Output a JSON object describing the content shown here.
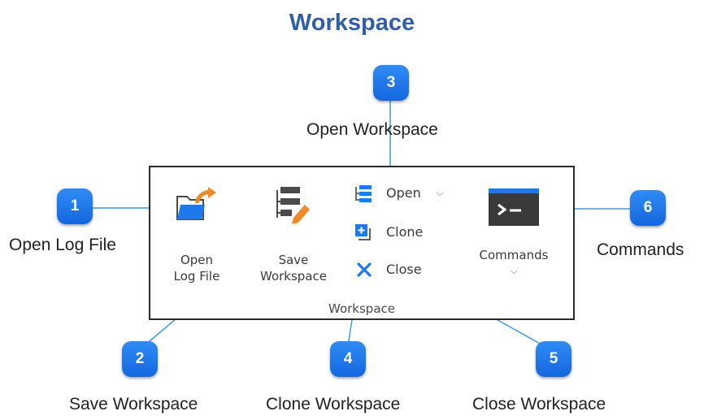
{
  "page_title": "Workspace",
  "ribbon": {
    "open_log_file": {
      "line1": "Open",
      "line2": "Log File",
      "icon": "folder-open-arrow-icon"
    },
    "save_workspace": {
      "line1": "Save",
      "line2": "Workspace",
      "icon": "save-workspace-icon"
    },
    "open": {
      "label": "Open",
      "icon": "workspace-list-icon",
      "dropdown": "chevron-down-icon"
    },
    "clone": {
      "label": "Clone",
      "icon": "clone-icon"
    },
    "close": {
      "label": "Close",
      "icon": "close-x-icon"
    },
    "commands": {
      "label": "Commands",
      "icon": "terminal-icon",
      "dropdown": "chevron-down-icon"
    },
    "group_label": "Workspace"
  },
  "callouts": [
    {
      "number": "1",
      "caption": "Open Log File"
    },
    {
      "number": "2",
      "caption": "Save Workspace"
    },
    {
      "number": "3",
      "caption": "Open Workspace"
    },
    {
      "number": "4",
      "caption": "Clone Workspace"
    },
    {
      "number": "5",
      "caption": "Close Workspace"
    },
    {
      "number": "6",
      "caption": "Commands"
    }
  ],
  "colors": {
    "title": "#2F5FA8",
    "badge": "#1E78EE",
    "leader_line": "#3C9BE8",
    "accent_orange": "#F08A24"
  }
}
